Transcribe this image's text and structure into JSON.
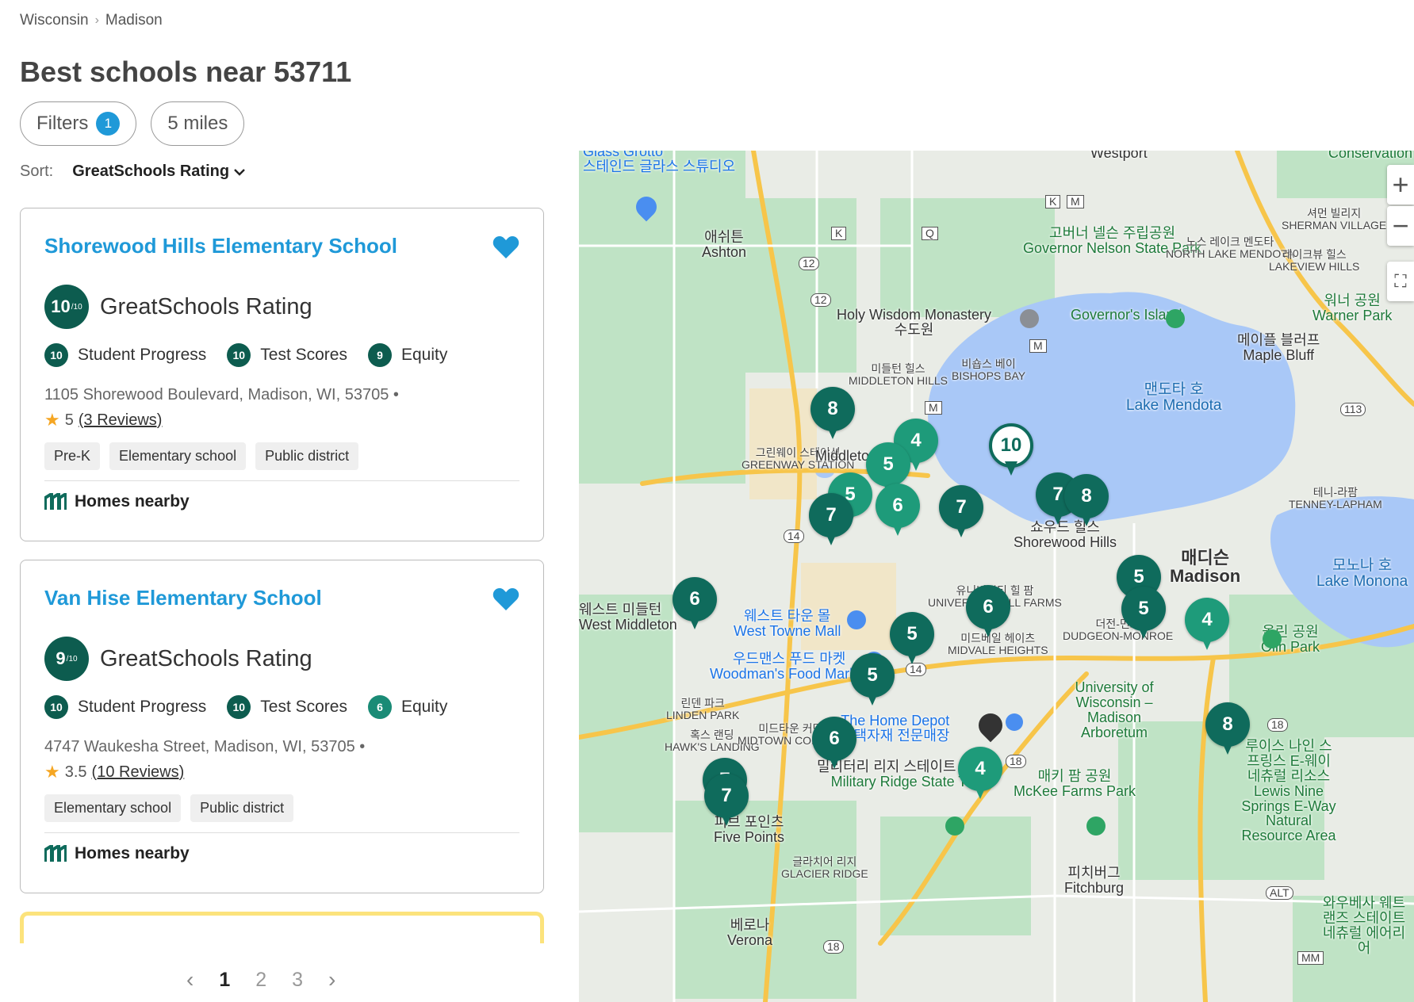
{
  "breadcrumb": {
    "state": "Wisconsin",
    "city": "Madison"
  },
  "title": "Best schools near 53711",
  "filters": {
    "label": "Filters",
    "count": "1",
    "radius": "5 miles"
  },
  "sort": {
    "label": "Sort:",
    "value": "GreatSchools Rating"
  },
  "rating_label": "GreatSchools Rating",
  "homes_nearby": "Homes nearby",
  "schools": [
    {
      "name": "Shorewood Hills Elementary School",
      "rating": "10",
      "rating_max": "/10",
      "student_progress": {
        "score": "10",
        "label": "Student Progress"
      },
      "test_scores": {
        "score": "10",
        "label": "Test Scores"
      },
      "equity": {
        "score": "9",
        "label": "Equity"
      },
      "address": "1105 Shorewood Boulevard, Madison, WI, 53705 •",
      "stars": "5",
      "reviews": "(3 Reviews)",
      "tags": [
        "Pre-K",
        "Elementary school",
        "Public district"
      ]
    },
    {
      "name": "Van Hise Elementary School",
      "rating": "9",
      "rating_max": "/10",
      "student_progress": {
        "score": "10",
        "label": "Student Progress"
      },
      "test_scores": {
        "score": "10",
        "label": "Test Scores"
      },
      "equity": {
        "score": "6",
        "label": "Equity"
      },
      "address": "4747 Waukesha Street, Madison, WI, 53705 •",
      "stars": "3.5",
      "reviews": "(10 Reviews)",
      "tags": [
        "Elementary school",
        "Public district"
      ]
    }
  ],
  "pagination": {
    "prev": "‹",
    "pages": [
      "1",
      "2",
      "3"
    ],
    "next": "›",
    "current": "1"
  },
  "map": {
    "labels": {
      "glass_grotto": "Glass Grotto",
      "glass_grotto_ko": "스테인드 글라스 스튜디오",
      "westport": "Westport",
      "ashton_ko": "애쉬튼",
      "ashton": "Ashton",
      "governor_nelson_ko": "고버너 넬슨 주립공원",
      "governor_nelson": "Governor Nelson State Park",
      "holy_wisdom": "Holy Wisdom Monastery",
      "holy_wisdom_ko": "수도원",
      "governors_island": "Governor's Island",
      "sherman_ko": "셔먼 빌리지",
      "sherman": "SHERMAN VILLAGE",
      "north_lake_ko": "노스 레이크 멘도타",
      "north_lake": "NORTH LAKE MENDOTA",
      "lakeview_ko": "레이크뷰 힐스",
      "lakeview": "LAKEVIEW HILLS",
      "warner_ko": "워너 공원",
      "warner": "Warner Park",
      "maple_bluff_ko": "메이플 블러프",
      "maple_bluff": "Maple Bluff",
      "middleton_hills_ko": "미들턴 힐스",
      "middleton_hills": "MIDDLETON HILLS",
      "bishops_bay_ko": "비숍스 베이",
      "bishops_bay": "BISHOPS BAY",
      "lake_mendota_ko": "맨도타 호",
      "lake_mendota": "Lake Mendota",
      "greenway_ko": "그린웨이 스테이션",
      "greenway": "GREENWAY STATION",
      "middleton": "Middleton",
      "shorewood_ko": "쇼우드 힐스",
      "shorewood": "Shorewood Hills",
      "madison_ko": "매디슨",
      "madison": "Madison",
      "tenney_ko": "테니-라팜",
      "tenney": "TENNEY-LAPHAM",
      "lake_monona_ko": "모노나 호",
      "lake_monona": "Lake Monona",
      "west_middleton_ko": "웨스트 미들턴",
      "west_middleton": "West Middleton",
      "west_towne_ko": "웨스트 타운 몰",
      "west_towne": "West Towne Mall",
      "university_hill_ko": "유니버시티 힐 팜",
      "university_hill": "UNIVERSITY HILL FARMS",
      "dudgeon_ko": "더전-먼로",
      "dudgeon": "DUDGEON-MONROE",
      "woodmans_ko": "우드맨스 푸드 마켓",
      "woodmans": "Woodman's Food Market",
      "midvale_ko": "미드베일 헤이츠",
      "midvale": "MIDVALE HEIGHTS",
      "uw_arboretum": "University of Wisconsin –Madison Arboretum",
      "linden_ko": "린덴 파크",
      "linden": "LINDEN PARK",
      "home_depot": "The Home Depot",
      "home_depot_ko": "주택자재 전문매장",
      "hawks_ko": "혹스 랜딩",
      "hawks": "HAWK'S LANDING",
      "midtown_ko": "미드타운 커먼스",
      "midtown": "MIDTOWN COMMONS",
      "military_ridge_ko": "밀리터리 리지 스테이트 트레일",
      "military_ridge": "Military Ridge State Trail",
      "mckee_ko": "매키 팜 공원",
      "mckee": "McKee Farms Park",
      "lewis_ko": "루이스 나인 스프링스 E-웨이 네츄럴 리소스",
      "lewis": "Lewis Nine Springs E-Way Natural Resource Area",
      "five_points_ko": "피브 포인츠",
      "five_points": "Five Points",
      "glacier_ko": "글라치어 리지",
      "glacier": "GLACIER RIDGE",
      "fitchburg_ko": "피치버그",
      "fitchburg": "Fitchburg",
      "verona_ko": "베로나",
      "verona": "Verona",
      "waubesa_ko": "와우베사 웨트랜즈 스테이트 네츄럴 에어리어",
      "conservation": "Conservation Park - North",
      "olin_ko": "올린 공원",
      "olin": "Olin Park"
    },
    "route_shields": [
      "12",
      "12",
      "14",
      "14",
      "18",
      "18",
      "18",
      "113",
      "M",
      "K",
      "Q",
      "K",
      "M",
      "M",
      "MM",
      "ALT"
    ],
    "pins": [
      "8",
      "4",
      "5",
      "10",
      "5",
      "7",
      "6",
      "7",
      "7",
      "8",
      "5",
      "5",
      "4",
      "6",
      "6",
      "5",
      "5",
      "6",
      "8",
      "4",
      "7",
      "7"
    ],
    "zoom_in": "+",
    "zoom_out": "−",
    "colors": {
      "pin_dark": "#0f6b5c",
      "pin_light": "#1e9b7a",
      "water": "#a9c8f7",
      "land": "#e9ece6",
      "park": "#bfe3c5"
    }
  }
}
